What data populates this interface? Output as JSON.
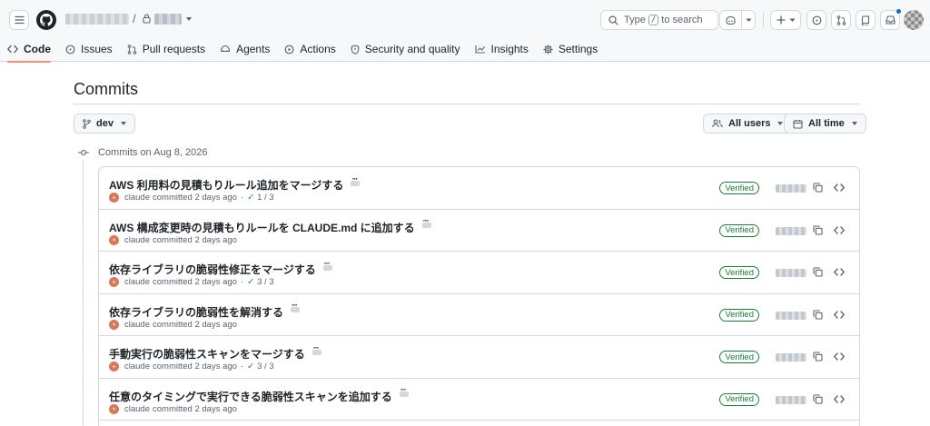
{
  "header": {
    "breadcrumb_separator": "/",
    "search": {
      "label_before": "Type",
      "shortcut": "/",
      "label_after": "to search"
    }
  },
  "tabs": [
    {
      "label": "Code",
      "icon": "code-icon",
      "selected": true
    },
    {
      "label": "Issues",
      "icon": "issue-icon"
    },
    {
      "label": "Pull requests",
      "icon": "pull-request-icon"
    },
    {
      "label": "Agents",
      "icon": "agents-icon"
    },
    {
      "label": "Actions",
      "icon": "play-icon"
    },
    {
      "label": "Security and quality",
      "icon": "shield-icon"
    },
    {
      "label": "Insights",
      "icon": "graph-icon"
    },
    {
      "label": "Settings",
      "icon": "gear-icon"
    }
  ],
  "main": {
    "title": "Commits",
    "branch": "dev",
    "users_filter": "All users",
    "time_filter": "All time",
    "group_label": "Commits on Aug 8, 2026"
  },
  "commits": [
    {
      "title": "AWS 利用料の見積もりルール追加をマージする",
      "author": "claude",
      "meta": "committed 2 days ago",
      "checks": "1 / 3",
      "verified": "Verified"
    },
    {
      "title": "AWS 構成変更時の見積もりルールを CLAUDE.md に追加する",
      "author": "claude",
      "meta": "committed 2 days ago",
      "checks": "",
      "verified": "Verified"
    },
    {
      "title": "依存ライブラリの脆弱性修正をマージする",
      "author": "claude",
      "meta": "committed 2 days ago",
      "checks": "3 / 3",
      "verified": "Verified"
    },
    {
      "title": "依存ライブラリの脆弱性を解消する",
      "author": "claude",
      "meta": "committed 2 days ago",
      "checks": "",
      "verified": "Verified"
    },
    {
      "title": "手動実行の脆弱性スキャンをマージする",
      "author": "claude",
      "meta": "committed 2 days ago",
      "checks": "3 / 3",
      "verified": "Verified"
    },
    {
      "title": "任意のタイミングで実行できる脆弱性スキャンを追加する",
      "author": "claude",
      "meta": "committed 2 days ago",
      "checks": "",
      "verified": "Verified"
    }
  ],
  "colors": {
    "accent_tab_underline": "#fd8c73",
    "verified_green": "#1a7f37",
    "notification_dot": "#0969da",
    "claude_avatar": "#d97757"
  }
}
